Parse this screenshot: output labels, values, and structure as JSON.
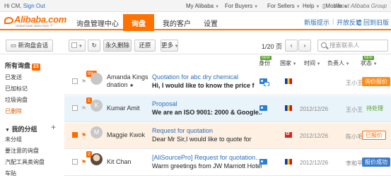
{
  "topbar": {
    "greeting": "Hi CM,",
    "sign_out": "Sign Out",
    "menus": [
      "My Alibaba",
      "For Buyers",
      "For Sellers",
      "Help",
      "Mobile"
    ],
    "about": "About Alibaba Group"
  },
  "header": {
    "brand": "Alibaba.com",
    "tagline": "Global trade starts here.™",
    "app_title": "询盘管理中心",
    "tabs": [
      "询盘",
      "我的客户",
      "设置"
    ],
    "links": [
      "新版提示",
      "开放反馈",
      "回到旧版"
    ]
  },
  "toolbar": {
    "new_button": "新询盘会话",
    "delete_button": "永久删除",
    "restore_button": "还原",
    "more_button": "更多",
    "pager": "1/20 页",
    "search_placeholder": "搜索联系人"
  },
  "sidebar": {
    "all_label": "所有询盘",
    "all_count": "23",
    "items": [
      "已发送",
      "已加标记",
      "垃圾询盘",
      "已删除"
    ],
    "group_label": "我的分组",
    "groups": [
      "未分组",
      "要注意的询盘",
      "汽配工具类询盘",
      "车贴"
    ]
  },
  "columns": {
    "identity": "身份",
    "country": "国家",
    "time": "时间",
    "owner": "负责人",
    "status": "状态",
    "new_tag": "NEW"
  },
  "rows": [
    {
      "count": "99+",
      "avatar": "",
      "name": "Amanda Kings",
      "name2": "dnation",
      "subject": "Quotation for abc dry chemical",
      "preview": "Hi, I would like to know the price for...",
      "date": "",
      "owner": "王小王",
      "status": "询价报价"
    },
    {
      "count": "1",
      "avatar": "K",
      "name": "Kumar Amit",
      "name2": "",
      "subject": "Proposal",
      "preview": "We are an ISO 9001: 2000 & Google...",
      "date": "2012/12/26",
      "owner": "王小王",
      "status": "待处理"
    },
    {
      "count": "",
      "avatar": "M",
      "name": "Maggie Kwok",
      "name2": "",
      "subject": "Request for quotation",
      "preview": "Dear Mr Sir,I would like to quote for",
      "date": "2012/12/26",
      "owner": "陈小毛",
      "status": "已报价"
    },
    {
      "count": "2",
      "avatar": "",
      "name": "Kit Chan",
      "name2": "",
      "subject": "[AliSourcePro] Request for quotation...",
      "preview": "Warm greetings from JW Marriott Hotel",
      "date": "2012/12/26",
      "owner": "李和平",
      "status": "报价成功"
    }
  ],
  "colors": {
    "accent": "#ff7200",
    "link": "#2a6ebb",
    "selected_row": "#fef1e4",
    "highlight_row": "#e9f3fa"
  }
}
